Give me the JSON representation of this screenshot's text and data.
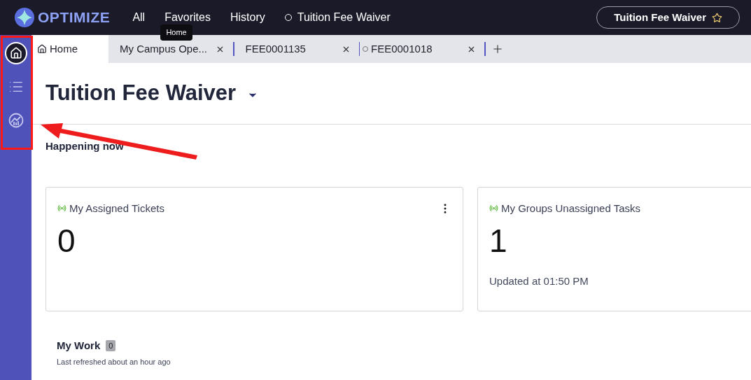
{
  "top_bar": {
    "logo": "OPTIMIZE",
    "nav": [
      {
        "label": "All",
        "kind": "plain"
      },
      {
        "label": "Favorites",
        "kind": "plain"
      },
      {
        "label": "History",
        "kind": "plain"
      },
      {
        "label": "Tuition Fee Waiver",
        "kind": "dot"
      }
    ],
    "tooltip": "Home",
    "context_button": "Tuition Fee Waiver"
  },
  "sidebar": {
    "items": [
      {
        "kind": "home",
        "selected": true
      },
      {
        "kind": "list",
        "selected": false
      },
      {
        "kind": "chart",
        "selected": false
      }
    ]
  },
  "tabs": [
    {
      "label": "Home",
      "kind": "home",
      "selected": true
    },
    {
      "label": "My Campus Ope...",
      "kind": "closable",
      "selected": false
    },
    {
      "label": "FEE0001135",
      "kind": "closable",
      "selected": false
    },
    {
      "label": "FEE0001018",
      "kind": "dot",
      "selected": false
    }
  ],
  "page": {
    "title": "Tuition Fee Waiver",
    "section": "Happening now",
    "cards": [
      {
        "title": "My Assigned Tickets",
        "count": "0",
        "menu": true
      },
      {
        "title": "My Groups Unassigned Tasks",
        "count": "1",
        "updated": "Updated at 01:50 PM",
        "menu": false
      }
    ],
    "work": {
      "title": "My Work",
      "count": "0",
      "refreshed": "Last refreshed about an hour ago"
    }
  }
}
